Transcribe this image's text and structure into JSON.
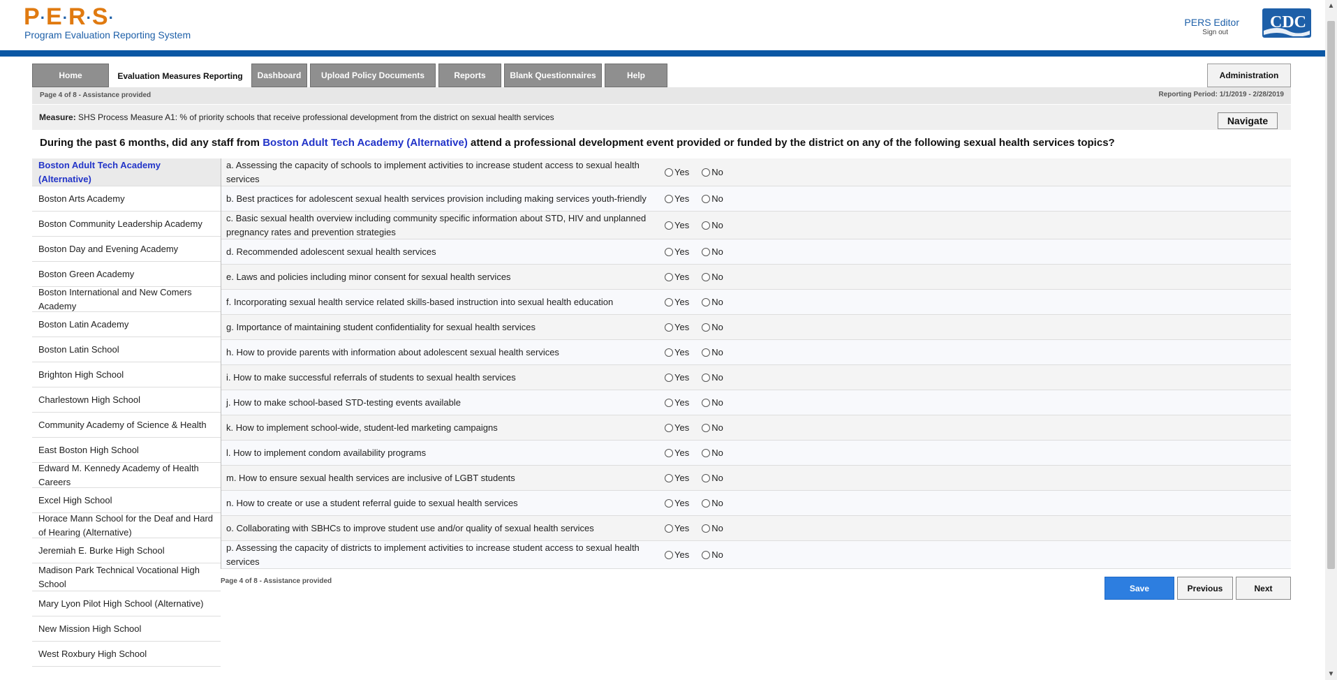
{
  "header": {
    "logo": "P·E·R·S",
    "subtitle": "Program Evaluation Reporting System",
    "user": "PERS Editor",
    "sign_out": "Sign out",
    "agency_logo": "CDC",
    "accent_color": "#0b57a4",
    "logo_color": "#e07a10"
  },
  "tabs": [
    {
      "label": "Home",
      "active": false
    },
    {
      "label": "Evaluation Measures Reporting",
      "active": true
    },
    {
      "label": "Dashboard",
      "active": false
    },
    {
      "label": "Upload Policy Documents",
      "active": false
    },
    {
      "label": "Reports",
      "active": false
    },
    {
      "label": "Blank Questionnaires",
      "active": false
    },
    {
      "label": "Help",
      "active": false
    }
  ],
  "admin_button": "Administration",
  "page_info": "Page 4 of 8 - Assistance provided",
  "reporting_period": "Reporting Period: 1/1/2019 - 2/28/2019",
  "measure": {
    "label": "Measure:",
    "text": "SHS Process Measure A1: % of priority schools that receive professional development from the district on sexual health services"
  },
  "navigate_button": "Navigate",
  "question": {
    "prefix": "During the past 6 months, did any staff from ",
    "school": "Boston Adult Tech Academy (Alternative)",
    "suffix": " attend a professional development event provided or funded by the district on any of the following sexual health services topics?"
  },
  "schools": [
    "Boston Adult Tech Academy (Alternative)",
    "Boston Arts Academy",
    "Boston Community Leadership Academy",
    "Boston Day and Evening Academy",
    "Boston Green Academy",
    "Boston International and New Comers Academy",
    "Boston Latin Academy",
    "Boston Latin School",
    "Brighton High School",
    "Charlestown High School",
    "Community Academy of Science & Health",
    "East Boston High School",
    "Edward M. Kennedy Academy of Health Careers",
    "Excel High School",
    "Horace Mann School for the Deaf and Hard of Hearing (Alternative)",
    "Jeremiah E. Burke High School",
    "Madison Park Technical Vocational High School",
    "Mary Lyon Pilot High School (Alternative)",
    "New Mission High School",
    "West Roxbury High School"
  ],
  "active_school_index": 0,
  "topics": [
    "a. Assessing the capacity of schools to implement activities to increase student access to sexual health services",
    "b. Best practices for adolescent sexual health services provision including making services youth-friendly",
    "c. Basic sexual health overview including community specific information about STD, HIV and unplanned pregnancy rates and prevention strategies",
    "d. Recommended adolescent sexual health services",
    "e. Laws and policies including minor consent for sexual health services",
    "f. Incorporating sexual health service related skills-based instruction into sexual health education",
    "g. Importance of maintaining student confidentiality for sexual health services",
    "h. How to provide parents with information about adolescent sexual health services",
    "i. How to make successful referrals of students to sexual health services",
    "j. How to make school-based STD-testing events available",
    "k. How to implement school-wide, student-led marketing campaigns",
    "l. How to implement condom availability programs",
    "m. How to ensure sexual health services are inclusive of LGBT students",
    "n. How to create or use a student referral guide to sexual health services",
    "o. Collaborating with SBHCs to improve student use and/or quality of sexual health services",
    "p. Assessing the capacity of districts to implement activities to increase student access to sexual health services"
  ],
  "options": {
    "yes": "Yes",
    "no": "No"
  },
  "buttons": {
    "save": "Save",
    "previous": "Previous",
    "next": "Next"
  }
}
